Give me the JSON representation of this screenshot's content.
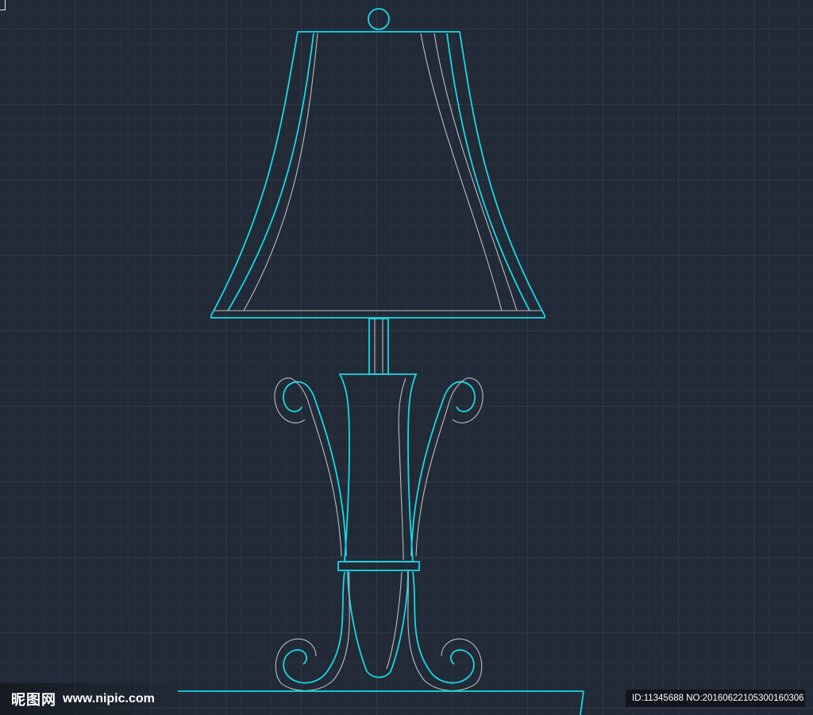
{
  "watermark": {
    "logo_text": "昵图网",
    "url_text": "www.nipic.com"
  },
  "image_id": {
    "text": "ID:11345688 NO:20160622105300160306"
  },
  "drawing": {
    "subject": "table-lamp",
    "colors": {
      "background": "#212a36",
      "grid": "#2f3a48",
      "outline": "#18d8e6",
      "detail": "#b9bec6"
    }
  }
}
